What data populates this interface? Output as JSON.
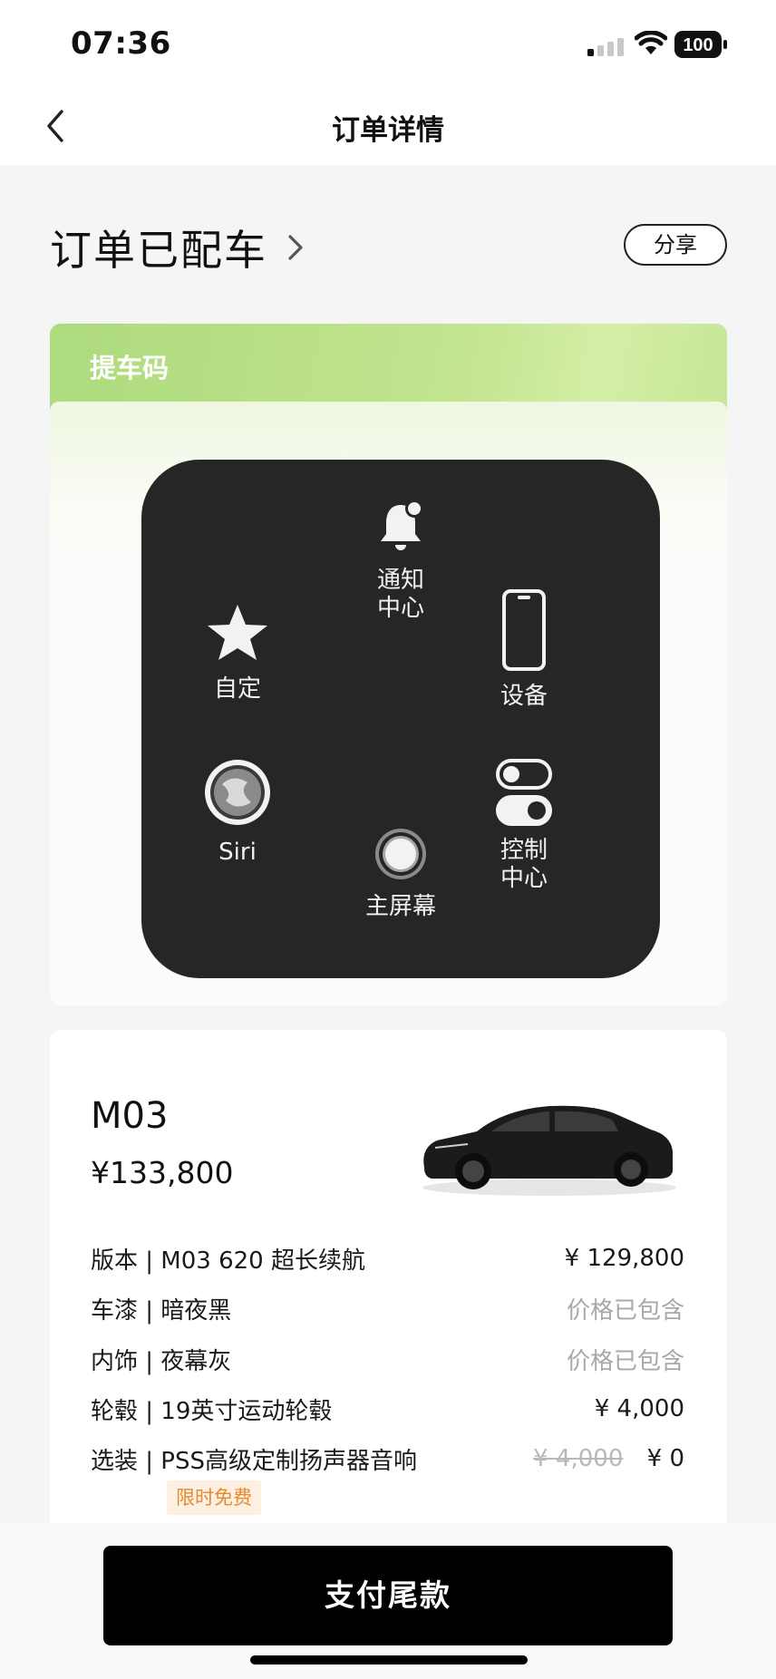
{
  "status_bar": {
    "time": "07:36",
    "battery": "100"
  },
  "nav": {
    "title": "订单详情"
  },
  "order": {
    "status": "订单已配车",
    "share_label": "分享"
  },
  "pickup": {
    "title": "提车码"
  },
  "assistive_touch": {
    "notification_center": [
      "通知",
      "中心"
    ],
    "custom": "自定",
    "device": "设备",
    "siri": "Siri",
    "control_center": [
      "控制",
      "中心"
    ],
    "home": "主屏幕"
  },
  "vehicle": {
    "model": "M03",
    "total_price": "¥133,800",
    "specs": [
      {
        "label": "版本 | M03 620 超长续航",
        "value": "¥ 129,800"
      },
      {
        "label": "车漆 | 暗夜黑",
        "value": "价格已包含"
      },
      {
        "label": "内饰 | 夜幕灰",
        "value": "价格已包含"
      },
      {
        "label": "轮毂 | 19英寸运动轮毂",
        "value": "¥ 4,000"
      },
      {
        "label": "选装 | PSS高级定制扬声器音响",
        "original_price": "¥ 4,000",
        "value": "¥ 0"
      }
    ],
    "promo_badge": "限时免费"
  },
  "footer": {
    "pay_label": "支付尾款"
  },
  "colors": {
    "pickup_green": "#addb7d",
    "promo_orange": "#e48a2e",
    "primary": "#000000"
  }
}
